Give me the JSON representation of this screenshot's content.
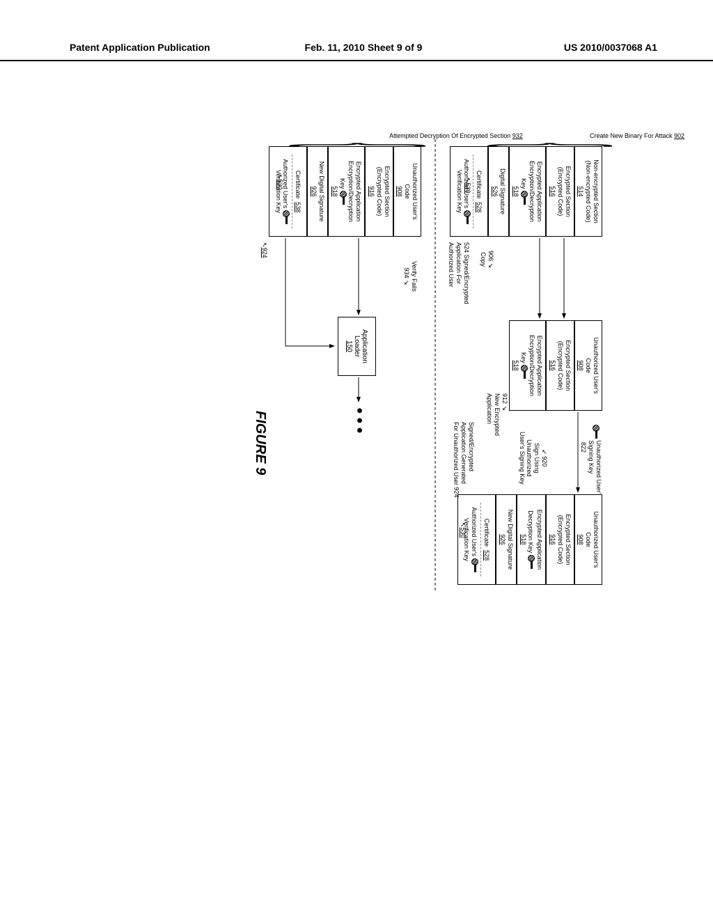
{
  "header": {
    "left": "Patent Application Publication",
    "center": "Feb. 11, 2010  Sheet 9 of 9",
    "right": "US 2010/0037068 A1"
  },
  "figure_label": "FIGURE 9",
  "section_labels": {
    "create_new_binary": "Create New Binary For Attack",
    "create_new_binary_ref": "902",
    "attempted_decryption": "Attempted Decryption Of Encrypted Section",
    "attempted_decryption_ref": "932"
  },
  "stack_a": {
    "box1": {
      "l1": "Non-encrypted Section",
      "l2": "(Non-encrypted Code)",
      "ref": "514"
    },
    "box2": {
      "l1": "Encrypted Section",
      "l2": "(Encrypted Code)",
      "ref": "516"
    },
    "box3": {
      "l1": "Encrypted Application",
      "l2": "Encryption/Decryption",
      "l3": "Key",
      "ref": "518"
    },
    "box4": {
      "l1": "Digital Signature",
      "ref": "526"
    },
    "box5": {
      "l1": "Certificate",
      "ref": "528",
      "sub1": "Authorized User's",
      "sub2": "Verification Key",
      "subref": "530"
    }
  },
  "stack_b": {
    "box1": {
      "l1": "Unauthorized User's",
      "l2": "Code",
      "ref": "908"
    },
    "box2": {
      "l1": "Encrypted Section",
      "l2": "(Encrypted Code)",
      "ref": "516"
    },
    "box3": {
      "l1": "Encrypted Application",
      "l2": "Encryption/Decryption",
      "l3": "Key",
      "ref": "518"
    }
  },
  "stack_c": {
    "box1": {
      "l1": "Unauthorized User's",
      "l2": "Code",
      "ref": "908"
    },
    "box2": {
      "l1": "Encrypted Section",
      "l2": "(Encrypted Code)",
      "ref": "916"
    },
    "box3": {
      "l1": "Encrypted Application",
      "l2": "Decryption Key",
      "ref": "518"
    },
    "box4": {
      "l1": "New Digital Signature",
      "ref": "926"
    },
    "box5": {
      "l1": "Certificate",
      "ref": "528",
      "sub1": "Authorized User's",
      "sub2": "Verification Key",
      "subref": "530"
    }
  },
  "stack_d": {
    "box1": {
      "l1": "Unauthorized User's",
      "l2": "Code",
      "ref": "908"
    },
    "box2": {
      "l1": "Encrypted Section",
      "l2": "(Encrypted Code)",
      "ref": "916"
    },
    "box3": {
      "l1": "Encrypted Application",
      "l2": "Encryption/Decryption",
      "l3": "Key",
      "ref": "518"
    },
    "box4": {
      "l1": "New Digital Signature",
      "ref": "926"
    },
    "box5": {
      "l1": "Certificate",
      "ref": "538",
      "sub1": "Authorized User's",
      "sub2": "Verification Key",
      "subref": "530"
    }
  },
  "app_loader": {
    "l1": "Application",
    "l2": "Loader",
    "ref": "150"
  },
  "arrows": {
    "copy": "Copy",
    "copy_ref": "906",
    "signed_auth": "Signed/Encrypted\nApplication For\nAuthorized User",
    "signed_auth_ref": "524",
    "unauth_sign_key": "Unauthorized User's\nSigning Key",
    "unauth_sign_key_ref": "822",
    "sign_using": "Sign Using\nUnauthorized\nUser's Signing Key",
    "sign_using_ref": "920",
    "new_enc_app": "New Encrypted\nApplication",
    "new_enc_app_ref": "912",
    "signed_unauth": "Signed/Encrypted\nApplication Generated\nFor Unauthorized User",
    "signed_unauth_ref": "924",
    "verify_fails": "Verify Fails",
    "verify_fails_ref": "934",
    "bottom_ref": "924"
  }
}
